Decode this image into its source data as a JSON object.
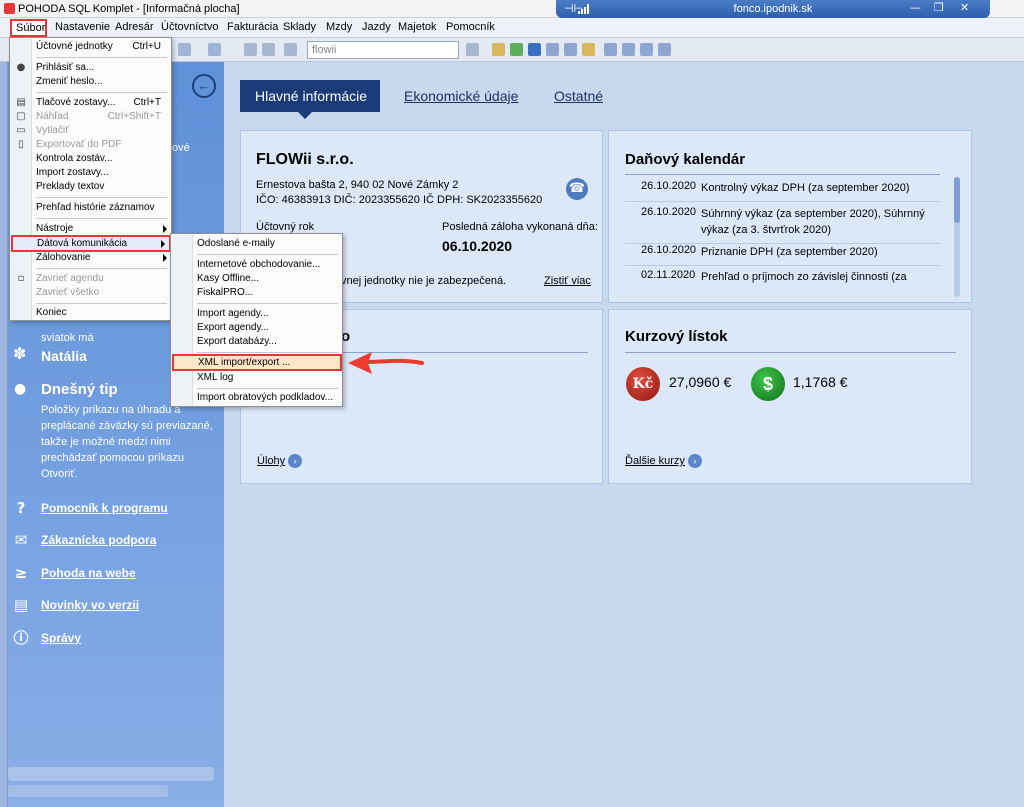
{
  "window": {
    "title": "POHODA SQL Komplet - [Informačná plocha]",
    "remote_host": "fonco.ipodnik.sk"
  },
  "menubar": {
    "items": [
      "Súbor",
      "Nastavenie",
      "Adresár",
      "Účtovníctvo",
      "Fakturácia",
      "Sklady",
      "Mzdy",
      "Jazdy",
      "Majetok",
      "Pomocník"
    ]
  },
  "toolbar": {
    "search_placeholder": "flowii"
  },
  "file_menu": {
    "items": [
      {
        "label": "Účtovné jednotky",
        "shortcut": "Ctrl+U"
      },
      {
        "label": "Prihlásiť sa..."
      },
      {
        "label": "Zmeniť heslo..."
      },
      {
        "label": "Tlačové zostavy...",
        "shortcut": "Ctrl+T"
      },
      {
        "label": "Náhľad",
        "shortcut": "Ctrl+Shift+T",
        "disabled": true
      },
      {
        "label": "Vytlačiť",
        "disabled": true
      },
      {
        "label": "Exportovať do PDF",
        "disabled": true
      },
      {
        "label": "Kontrola zostáv..."
      },
      {
        "label": "Import zostavy..."
      },
      {
        "label": "Preklady textov"
      },
      {
        "label": "Prehľad histórie záznamov"
      },
      {
        "label": "Nástroje"
      },
      {
        "label": "Dátová komunikácia"
      },
      {
        "label": "Zálohovanie"
      },
      {
        "label": "Zavrieť agendu",
        "disabled": true
      },
      {
        "label": "Zavrieť všetko",
        "disabled": true
      },
      {
        "label": "Koniec"
      }
    ]
  },
  "data_comm_menu": {
    "items": [
      {
        "label": "Odoslané e-maily"
      },
      {
        "label": "Internetové obchodovanie..."
      },
      {
        "label": "Kasy Offline..."
      },
      {
        "label": "FiskalPRO..."
      },
      {
        "label": "Import agendy..."
      },
      {
        "label": "Export agendy..."
      },
      {
        "label": "Export databázy..."
      },
      {
        "label": "XML import/export ..."
      },
      {
        "label": "XML log"
      },
      {
        "label": "Import obratových podkladov..."
      }
    ]
  },
  "left_panel": {
    "prefix_text": "ové",
    "nameday_label": "sviatok má",
    "nameday_name": "Natália",
    "tip_title": "Dnešný tip",
    "tip_text": "Položky príkazu na úhradu a preplácané záväzky sú previazané, takže je možné medzi nimi prechádzať pomocou príkazu Otvoriť.",
    "links": [
      "Pomocník k programu",
      "Zákaznícka podpora",
      "Pohoda na webe",
      "Novinky vo verzii",
      "Správy"
    ]
  },
  "tabs": [
    "Hlavné informácie",
    "Ekonomické údaje",
    "Ostatné"
  ],
  "company": {
    "name": "FLOWii s.r.o.",
    "address": "Ernestova bašta 2, 940 02 Nové Zámky 2",
    "ids": "IČO: 46383913  DIČ: 2023355620   IČ DPH: SK2023355620",
    "fiscal_label": "Účtovný rok",
    "backup_label": "Posledná záloha vykonaná dňa:",
    "backup_date": "06.10.2020",
    "warning": "vnej jednotky nie je zabezpečená.",
    "warning_link": "Zistiť viac"
  },
  "tax_calendar": {
    "title": "Daňový kalendár",
    "rows": [
      {
        "date": "26.10.2020",
        "text": "Kontrolný výkaz DPH (za september 2020)"
      },
      {
        "date": "26.10.2020",
        "text": "Súhrnný výkaz (za september 2020), Súhrnný výkaz (za 3. štvrťrok 2020)"
      },
      {
        "date": "26.10.2020",
        "text": "Priznanie DPH (za september 2020)"
      },
      {
        "date": "02.11.2020",
        "text": "Prehľad o príjmoch zo závislej činnosti (za"
      }
    ]
  },
  "tasks": {
    "title_tail": "o",
    "link": "Úlohy"
  },
  "exchange": {
    "title": "Kurzový lístok",
    "czk_symbol": "Kč",
    "czk_rate": "27,0960 €",
    "usd_symbol": "$",
    "usd_rate": "1,1768 €",
    "link": "Ďalšie kurzy"
  }
}
